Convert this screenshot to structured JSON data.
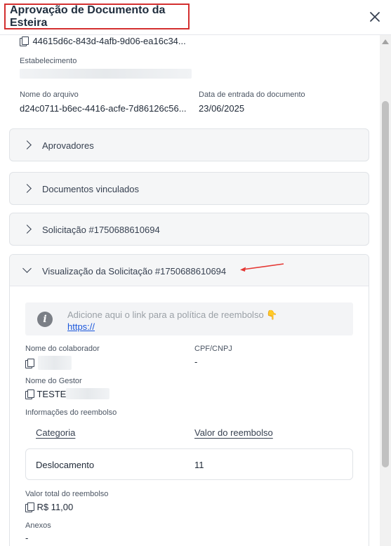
{
  "header": {
    "title": "Aprovação de Documento da Esteira"
  },
  "details": {
    "document_id": "44615d6c-843d-4afb-9d06-ea16c34...",
    "establishment_label": "Estabelecimento",
    "file_name_label": "Nome do arquivo",
    "file_name_value": "d24c0711-b6ec-4416-acfe-7d86126c56...",
    "entry_date_label": "Data de entrada do documento",
    "entry_date_value": "23/06/2025"
  },
  "accordions": [
    {
      "label": "Aprovadores"
    },
    {
      "label": "Documentos vinculados"
    },
    {
      "label": "Solicitação #1750688610694"
    }
  ],
  "expanded": {
    "label": "Visualização da Solicitação #1750688610694",
    "info_text": "Adicione aqui o link para a política de reembolso 👇",
    "info_link": "https://",
    "collaborator_label": "Nome do colaborador",
    "cpf_label": "CPF/CNPJ",
    "cpf_value": "-",
    "manager_label": "Nome do Gestor",
    "manager_value": "TESTE",
    "reimbursement_info_label": "Informações do reembolso",
    "table": {
      "columns": [
        "Categoria",
        "Valor do reembolso"
      ],
      "rows": [
        {
          "category": "Deslocamento",
          "value": "11"
        }
      ]
    },
    "total_label": "Valor total do reembolso",
    "total_value": "R$ 11,00",
    "attachments_label": "Anexos",
    "attachments_value": "-"
  },
  "colors": {
    "highlight_border": "#d32f2f",
    "annotation_arrow": "#e53935",
    "link": "#1a56db"
  },
  "icons": [
    "close-icon",
    "copy-icon",
    "chevron-right-icon",
    "chevron-down-icon",
    "info-icon",
    "arrow-annotation-icon"
  ]
}
